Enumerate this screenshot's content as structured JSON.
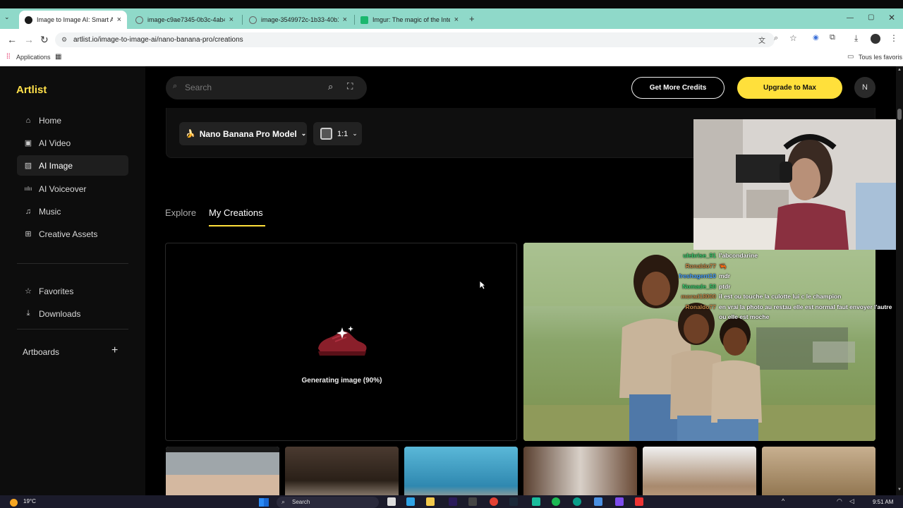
{
  "browser": {
    "tabs": [
      {
        "title": "Image to Image AI: Smart AI Im",
        "active": true,
        "icon_color": "#1a1a1a"
      },
      {
        "title": "image-c9ae7345-0b3c-4ab4-a",
        "active": false,
        "icon_color": "#666666"
      },
      {
        "title": "image-3549972c-1b33-40b1-a",
        "active": false,
        "icon_color": "#666666"
      },
      {
        "title": "Imgur: The magic of the Interne",
        "active": false,
        "icon_color": "#1bb76e"
      }
    ],
    "url": "artlist.io/image-to-image-ai/nano-banana-pro/creations",
    "bookmarks_apps": "Applications",
    "bookmarks_all": "Tous les favoris"
  },
  "sidebar": {
    "logo": "Artlist",
    "items": [
      {
        "label": "Home",
        "icon": "home-icon",
        "active": false
      },
      {
        "label": "AI Video",
        "icon": "video-icon",
        "active": false
      },
      {
        "label": "AI Image",
        "icon": "image-icon",
        "active": true
      },
      {
        "label": "AI Voiceover",
        "icon": "waveform-icon",
        "active": false
      },
      {
        "label": "Music",
        "icon": "music-note-icon",
        "active": false
      },
      {
        "label": "Creative Assets",
        "icon": "grid-icon",
        "active": false
      }
    ],
    "secondary": [
      {
        "label": "Favorites",
        "icon": "star-icon"
      },
      {
        "label": "Downloads",
        "icon": "download-icon"
      }
    ],
    "artboards_label": "Artboards"
  },
  "header": {
    "search_placeholder": "Search",
    "credits_label": "Get More Credits",
    "upgrade_label": "Upgrade to Max",
    "avatar_initial": "N"
  },
  "controls": {
    "model_label": "Nano Banana Pro Model",
    "model_emoji": "🍌",
    "ratio_label": "1:1"
  },
  "content_tabs": {
    "explore": "Explore",
    "mine": "My Creations"
  },
  "generation": {
    "status_text": "Generating image (90%)",
    "progress": 90
  },
  "chat": [
    {
      "user": "ulebrise_91",
      "color": "#3bd16f",
      "msg": "l'abcondarine"
    },
    {
      "user": "Ronaldo77",
      "color": "#c68a4a",
      "msg": "🦐"
    },
    {
      "user": "freshagent10",
      "color": "#4aa3ff",
      "msg": "mdr"
    },
    {
      "user": "Nomade_50",
      "color": "#3bd16f",
      "msg": "ptdr"
    },
    {
      "user": "morad18000",
      "color": "#c68a4a",
      "msg": "il est ou touche la culotte lui c le champion"
    },
    {
      "user": "Ronaldo77",
      "color": "#c68a4a",
      "msg": "en vrai la photo au restau elle est normal faut envoyer l'autre"
    },
    {
      "user": "",
      "color": "#c68a4a",
      "msg": "ou elle est moche"
    }
  ],
  "taskbar": {
    "weather": "19°C",
    "search": "Search",
    "time": "9:51 AM"
  }
}
